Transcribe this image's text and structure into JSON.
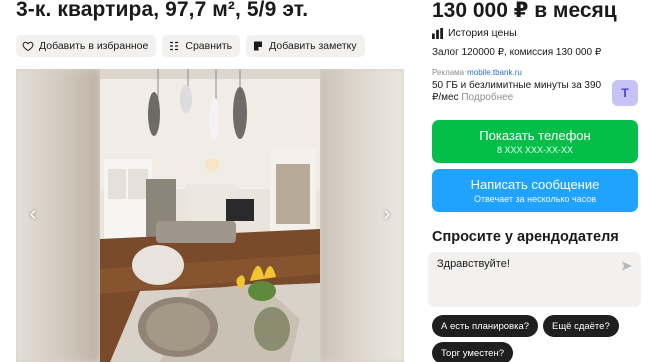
{
  "listing": {
    "title": "3-к. квартира, 97,7 м², 5/9 эт.",
    "price": "130 000 ₽ в месяц"
  },
  "actions": {
    "favorite": "Добавить в избранное",
    "compare": "Сравнить",
    "note": "Добавить заметку"
  },
  "price_info": {
    "history": "История цены",
    "deposit": "Залог 120000 ₽, комиссия 130 000 ₽"
  },
  "ad": {
    "label": "Реклама",
    "domain": "mobile.tbank.ru",
    "text": "50 ГБ и безлимитные минуты за 390 ₽/мес",
    "more": "Подробнее",
    "logo_letter": "Т"
  },
  "contact": {
    "phone_label": "Показать телефон",
    "phone_mask": "8 XXX XXX-XX-XX",
    "message_label": "Написать сообщение",
    "message_sub": "Отвечает за несколько часов"
  },
  "ask": {
    "title": "Спросите у арендодателя",
    "input_value": "Здравствуйте!",
    "chips": [
      "А есть планировка?",
      "Ещё сдаёте?",
      "Торг уместен?"
    ]
  },
  "colors": {
    "phone_button": "#03bf4a",
    "message_button": "#1fa3ff",
    "chip": "#1f1f1f"
  }
}
